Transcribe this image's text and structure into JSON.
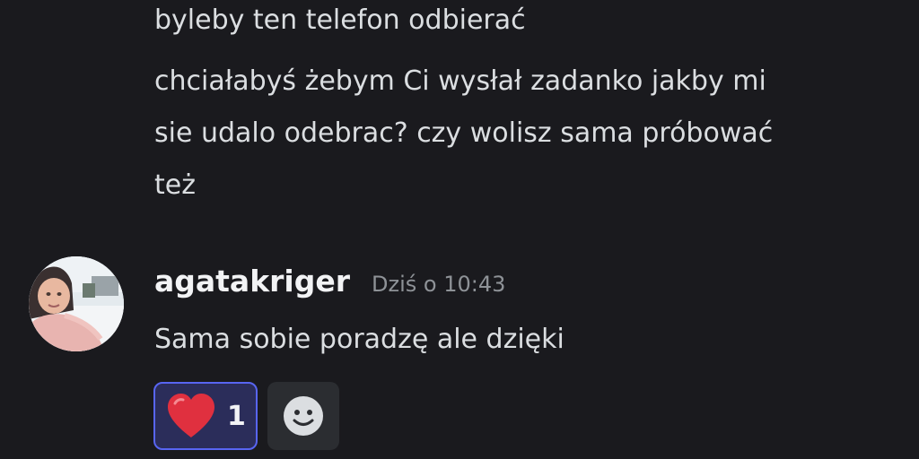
{
  "previous_message": {
    "lines": [
      "byleby ten telefon odbierać",
      "chciałabyś żebym Ci wysłał zadanko jakby mi",
      "sie udalo odebrac? czy wolisz sama próbować",
      "też"
    ]
  },
  "message": {
    "author": "agatakriger",
    "timestamp": "Dziś o 10:43",
    "text": "Sama sobie poradzę ale dzięki",
    "avatar_icon": "user-avatar-photo"
  },
  "reactions": [
    {
      "emoji": "heart-icon",
      "count": "1",
      "active": true
    }
  ],
  "add_reaction": {
    "icon": "smiley-face-icon"
  },
  "colors": {
    "background": "#1a1a1e",
    "text": "#dbdee1",
    "author": "#f2f3f5",
    "timestamp": "#8e9297",
    "reaction_border": "#5865f2",
    "reaction_bg": "#2b2d5a",
    "heart": "#e0303f"
  }
}
